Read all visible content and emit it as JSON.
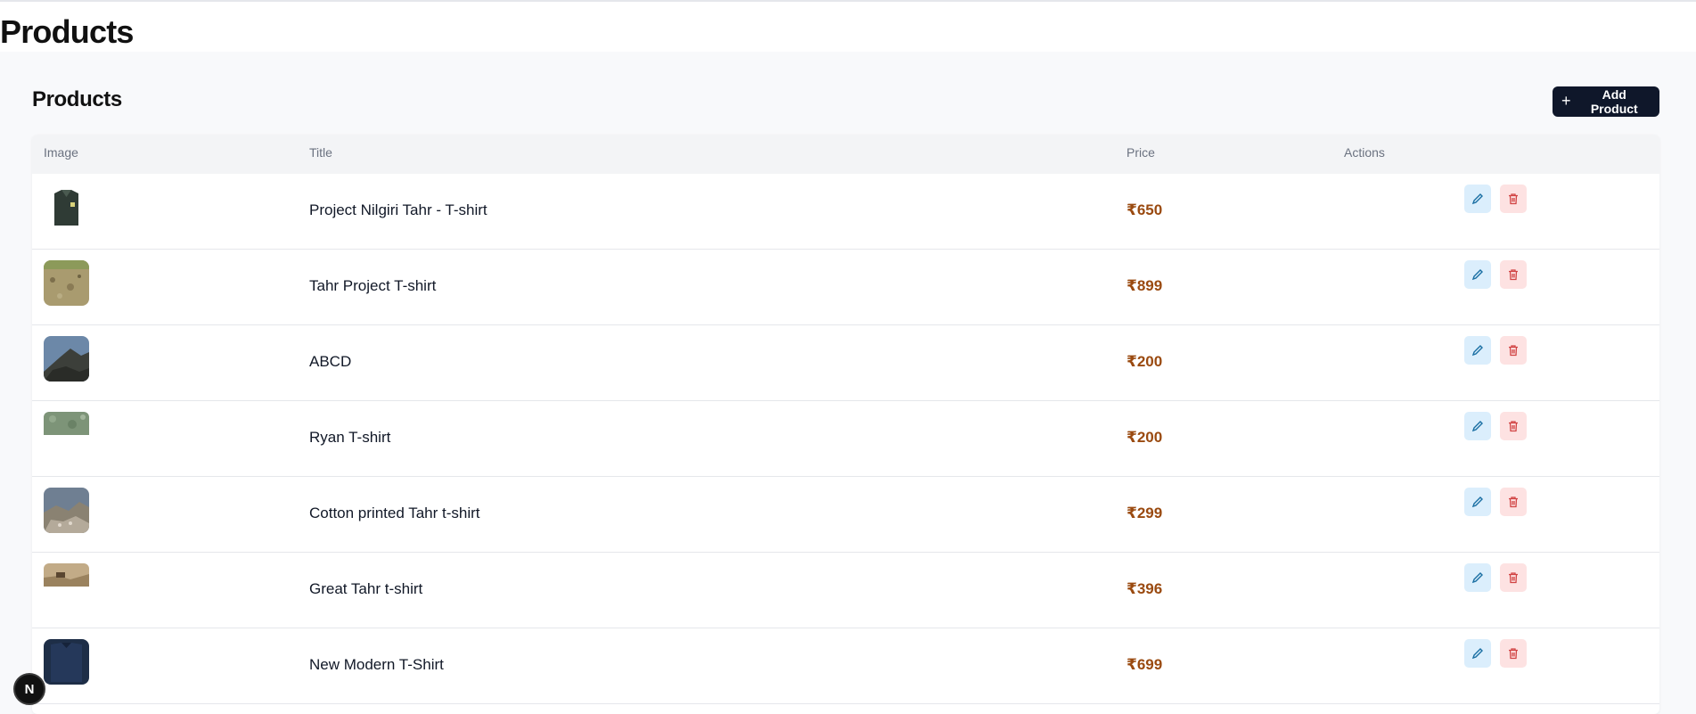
{
  "page": {
    "title": "Products"
  },
  "section": {
    "title": "Products",
    "add_button_label": "Add Product"
  },
  "table": {
    "headers": [
      "Image",
      "Title",
      "Price",
      "Actions"
    ],
    "rows": [
      {
        "title": "Project Nilgiri Tahr - T-shirt",
        "price": "₹650",
        "image": "green-vest"
      },
      {
        "title": "Tahr Project T-shirt",
        "price": "₹899",
        "image": "grassland"
      },
      {
        "title": "ABCD",
        "price": "₹200",
        "image": "cliff-sky"
      },
      {
        "title": "Ryan T-shirt",
        "price": "₹200",
        "image": "green-slope"
      },
      {
        "title": "Cotton printed Tahr t-shirt",
        "price": "₹299",
        "image": "mountain-herd"
      },
      {
        "title": "Great Tahr t-shirt",
        "price": "₹396",
        "image": "tahr-rock"
      },
      {
        "title": "New Modern T-Shirt",
        "price": "₹699",
        "image": "navy-shirt"
      }
    ]
  },
  "icons": {
    "edit": "pencil-icon",
    "delete": "trash-icon",
    "add": "plus-icon"
  },
  "colors": {
    "price": "#9a4a10",
    "edit_bg": "#dbeefc",
    "delete_bg": "#fde2e2",
    "primary_button": "#0f172a"
  },
  "badge": {
    "label": "N"
  }
}
